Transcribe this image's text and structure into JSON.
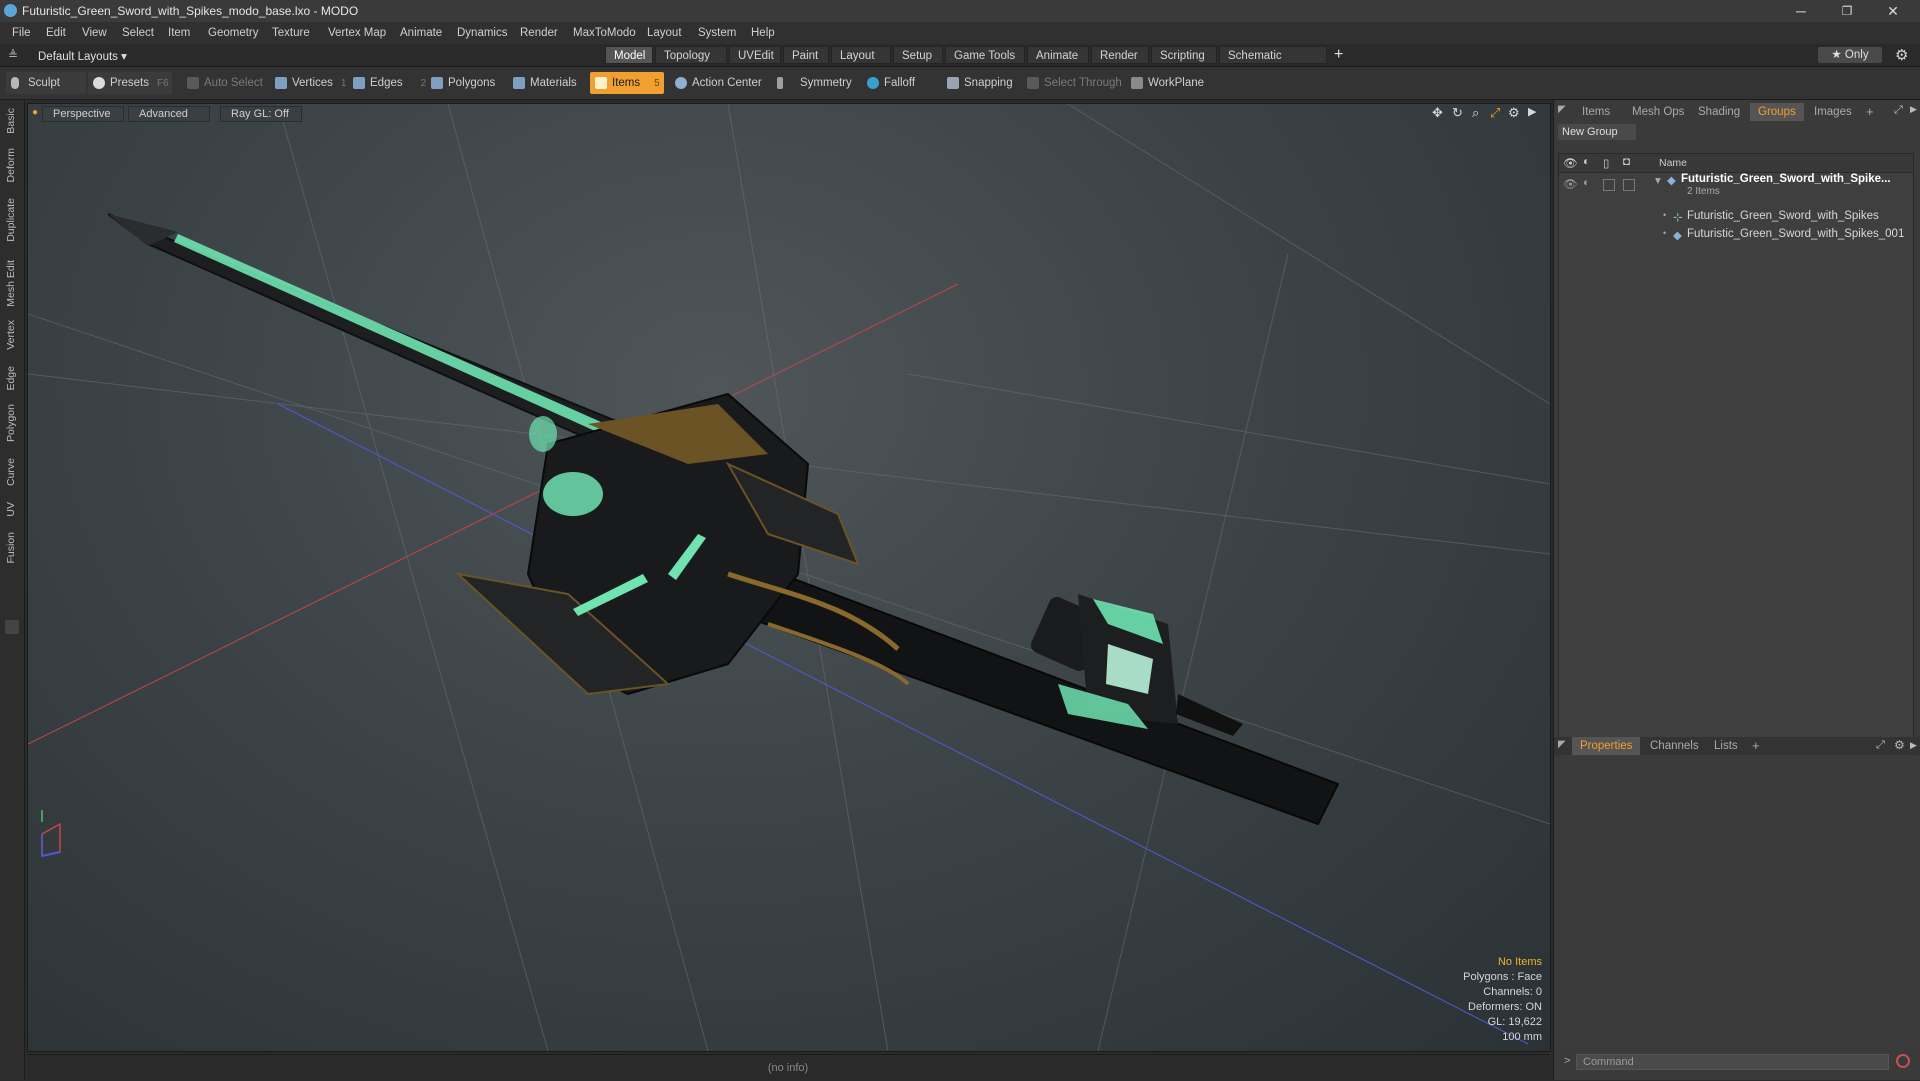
{
  "window": {
    "title": "Futuristic_Green_Sword_with_Spikes_modo_base.lxo - MODO",
    "minimize_glyph": "─",
    "restore_glyph": "❐",
    "close_glyph": "✕"
  },
  "menu": [
    "File",
    "Edit",
    "View",
    "Select",
    "Item",
    "Geometry",
    "Texture",
    "Vertex Map",
    "Animate",
    "Dynamics",
    "Render",
    "MaxToModo",
    "Layout",
    "System",
    "Help"
  ],
  "layoutbar": {
    "layouts_label": "Default Layouts ▾",
    "tabs": [
      "Model",
      "Topology",
      "UVEdit",
      "Paint",
      "Layout",
      "Setup",
      "Game Tools",
      "Animate",
      "Render",
      "Scripting",
      "Schematic Fusion"
    ],
    "active_tab": "Model",
    "add_glyph": "+",
    "only_label": "★  Only",
    "gear_glyph": "⚙"
  },
  "toolbar": {
    "sculpt": "Sculpt",
    "presets": "Presets",
    "presets_key": "F6",
    "auto_select": "Auto Select",
    "vertices": "Vertices",
    "vertices_count": "1",
    "edges": "Edges",
    "edges_count": "2",
    "polygons": "Polygons",
    "materials": "Materials",
    "items": "Items",
    "items_count": "5",
    "action_center": "Action Center",
    "symmetry": "Symmetry",
    "falloff": "Falloff",
    "snapping": "Snapping",
    "select_through": "Select Through",
    "workplane": "WorkPlane"
  },
  "left_tabs": [
    "Basic",
    "Deform",
    "Duplicate",
    "Mesh Edit",
    "Vertex",
    "Edge",
    "Polygon",
    "Curve",
    "UV",
    "Fusion"
  ],
  "viewport": {
    "view": "Perspective",
    "shading": "Advanced",
    "raygl": "Ray GL: Off",
    "info": {
      "selection": "No Items",
      "polygons": "Polygons : Face",
      "channels": "Channels: 0",
      "deformers": "Deformers: ON",
      "gl": "GL: 19,622",
      "scale": "100 mm"
    }
  },
  "status": {
    "text": "(no info)"
  },
  "right_panel": {
    "top_tabs": [
      "Items",
      "Mesh Ops",
      "Shading",
      "Groups",
      "Images"
    ],
    "active_top_tab": "Groups",
    "new_group": "New Group",
    "name_header": "Name",
    "group_name": "Futuristic_Green_Sword_with_Spike...",
    "group_count": "2 Items",
    "children": [
      "Futuristic_Green_Sword_with_Spikes",
      "Futuristic_Green_Sword_with_Spikes_001"
    ],
    "bottom_tabs": [
      "Properties",
      "Channels",
      "Lists"
    ],
    "active_bottom_tab": "Properties",
    "command_placeholder": "Command"
  },
  "colors": {
    "accent": "#f0a030",
    "glow": "#6fe3b0",
    "gold": "#8a6a2c",
    "axis_x": "#c84444",
    "axis_z": "#4f5bd6"
  }
}
